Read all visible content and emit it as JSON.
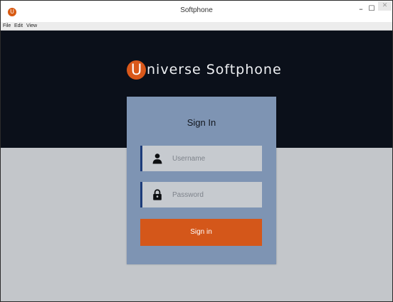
{
  "window": {
    "title": "Softphone",
    "app_icon": "U",
    "controls": {
      "minimize": "–",
      "maximize": "☐",
      "close": "✕"
    }
  },
  "menu": {
    "items": [
      "File",
      "Edit",
      "View"
    ]
  },
  "brand": {
    "initial": "U",
    "rest": "niverse Softphone"
  },
  "signin": {
    "title": "Sign In",
    "username_placeholder": "Username",
    "username_value": "",
    "password_placeholder": "Password",
    "password_value": "",
    "button_label": "Sign in"
  },
  "icons": {
    "username": "user-icon",
    "password": "lock-icon"
  },
  "colors": {
    "header_background": "#0b101a",
    "page_background": "#c3c6ca",
    "card_background": "#7e94b3",
    "field_background": "#c6cacf",
    "field_accent": "#1d3c7a",
    "brand_orange": "#d9581a",
    "button_background": "#d4571a",
    "button_text": "#ffffff"
  }
}
